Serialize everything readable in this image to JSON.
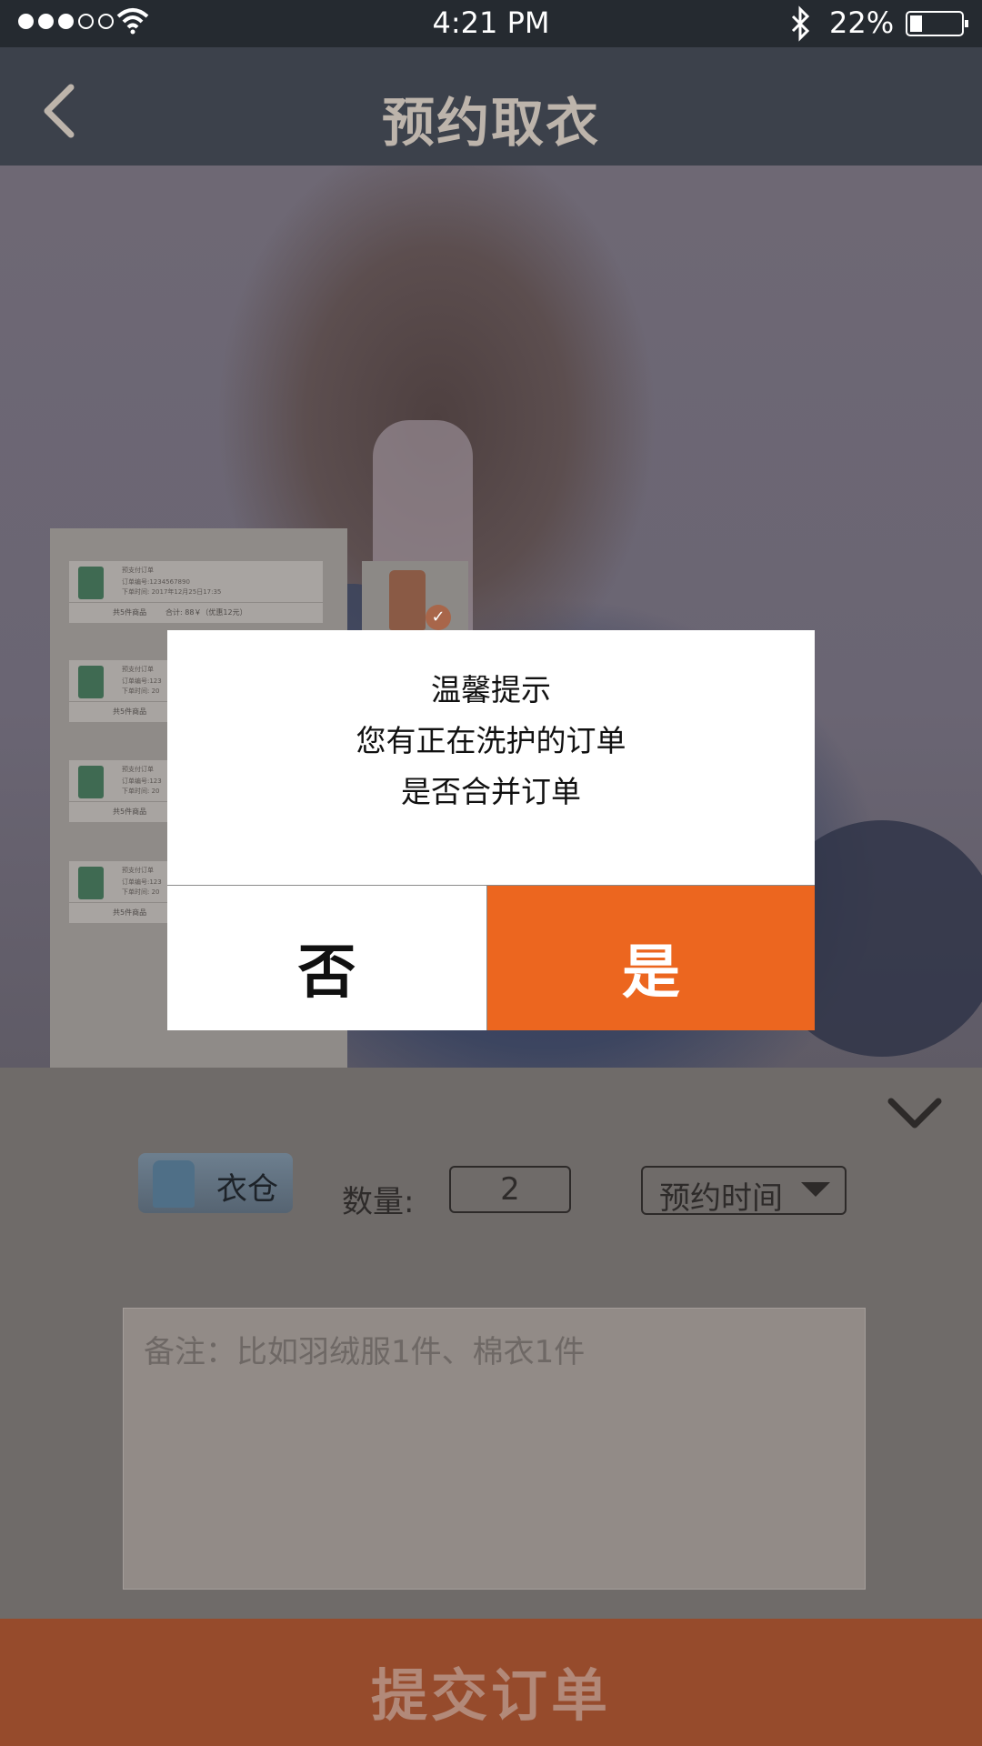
{
  "status_bar": {
    "time": "4:21 PM",
    "battery_percent": "22%",
    "battery_level": 0.22,
    "signal_bars_filled": 3,
    "signal_bars_total": 5
  },
  "nav": {
    "title": "预约取衣"
  },
  "order_list": {
    "orders": [
      {
        "title": "预支付订单",
        "order_no": "订单编号:1234567890",
        "order_time": "下单时间: 2017年12月25日17:35",
        "count": "共5件商品",
        "total": "合计: 88￥（优惠12元）"
      },
      {
        "title": "预支付订单",
        "order_no": "订单编号:123",
        "order_time": "下单时间: 20",
        "count": "共5件商品",
        "total": ""
      },
      {
        "title": "预支付订单",
        "order_no": "订单编号:123",
        "order_time": "下单时间: 20",
        "count": "共5件商品",
        "total": ""
      },
      {
        "title": "预支付订单",
        "order_no": "订单编号:123",
        "order_time": "下单时间: 20",
        "count": "共5件商品",
        "total": ""
      }
    ]
  },
  "controls": {
    "closet_label": "衣仓",
    "quantity_label": "数量:",
    "quantity_value": "2",
    "time_select_label": "预约时间",
    "note_placeholder": "备注：比如羽绒服1件、棉衣1件"
  },
  "submit_label": "提交订单",
  "dialog": {
    "title": "温馨提示",
    "line1": "您有正在洗护的订单",
    "line2": "是否合并订单",
    "no_label": "否",
    "yes_label": "是"
  },
  "colors": {
    "accent": "#EC661F",
    "nav_bg": "#3C414B",
    "status_bg": "#252A30",
    "submit_dimmed": "#964B2C"
  }
}
